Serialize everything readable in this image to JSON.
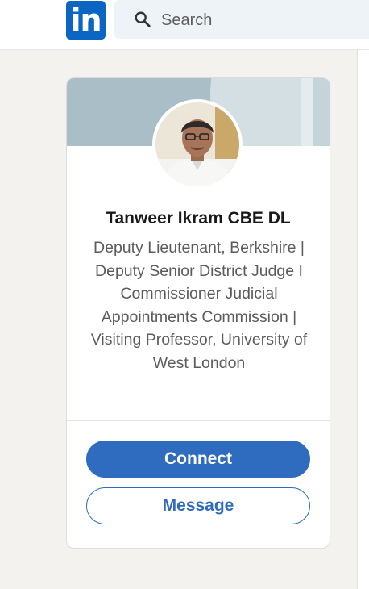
{
  "header": {
    "logo_text": "in",
    "search_placeholder": "Search"
  },
  "profile": {
    "name": "Tanweer Ikram CBE DL",
    "headline": "Deputy Lieutenant, Berkshire | Deputy Senior District Judge I Commissioner Judicial Appointments Commission | Visiting Professor, University of West London"
  },
  "actions": {
    "connect_label": "Connect",
    "message_label": "Message"
  },
  "colors": {
    "brand": "#0a66c2",
    "button_primary": "#2f6cbf",
    "page_background": "#f3f2ef"
  },
  "icons": {
    "logo": "linkedin-logo",
    "search": "search-icon"
  }
}
